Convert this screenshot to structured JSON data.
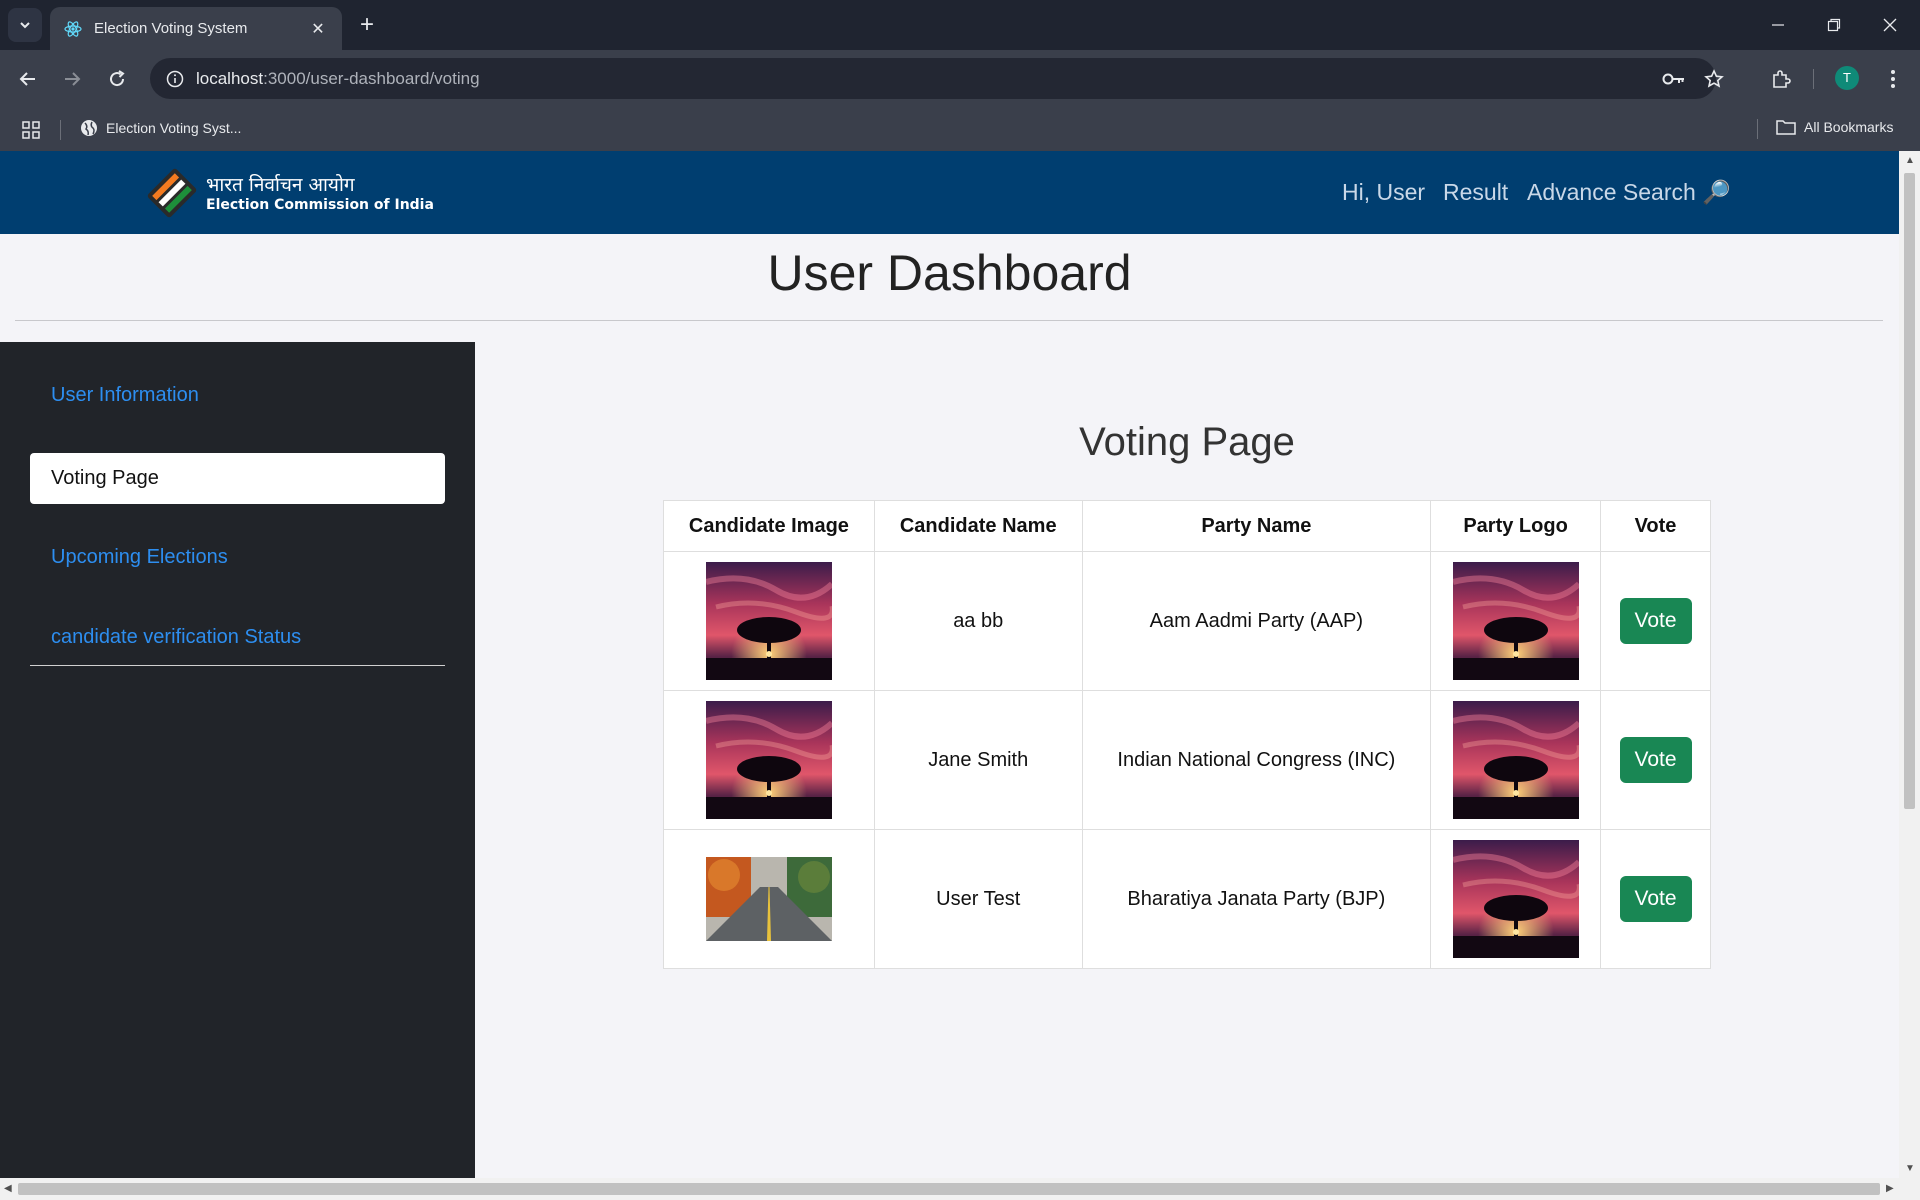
{
  "browser": {
    "tab_title": "Election Voting System",
    "url_host": "localhost",
    "url_rest": ":3000/user-dashboard/voting",
    "bookmark_label": "Election Voting Syst...",
    "all_bookmarks_label": "All Bookmarks",
    "profile_initial": "T"
  },
  "header": {
    "logo_hindi": "भारत निर्वाचन आयोग",
    "logo_english": "Election Commission of India",
    "nav": {
      "greeting": "Hi, User",
      "result": "Result",
      "advance_search": "Advance Search 🔎"
    }
  },
  "page": {
    "title": "User Dashboard"
  },
  "sidebar": {
    "items": [
      {
        "label": "User Information",
        "active": false
      },
      {
        "label": "Voting Page",
        "active": true
      },
      {
        "label": "Upcoming Elections",
        "active": false
      },
      {
        "label": "candidate verification Status",
        "active": false
      }
    ]
  },
  "voting": {
    "title": "Voting Page",
    "columns": [
      "Candidate Image",
      "Candidate Name",
      "Party Name",
      "Party Logo",
      "Vote"
    ],
    "rows": [
      {
        "candidate_name": "aa bb",
        "party_name": "Aam Aadmi Party (AAP)",
        "vote_label": "Vote",
        "candidate_image": "sunset-tree",
        "party_logo": "sunset-tree"
      },
      {
        "candidate_name": "Jane Smith",
        "party_name": "Indian National Congress (INC)",
        "vote_label": "Vote",
        "candidate_image": "sunset-tree",
        "party_logo": "sunset-tree"
      },
      {
        "candidate_name": "User Test",
        "party_name": "Bharatiya Janata Party (BJP)",
        "vote_label": "Vote",
        "candidate_image": "autumn-road",
        "party_logo": "sunset-tree"
      }
    ]
  },
  "colors": {
    "header_bg": "#003e70",
    "sidebar_bg": "#212429",
    "link": "#2d8ef0",
    "vote_button": "#198754"
  }
}
